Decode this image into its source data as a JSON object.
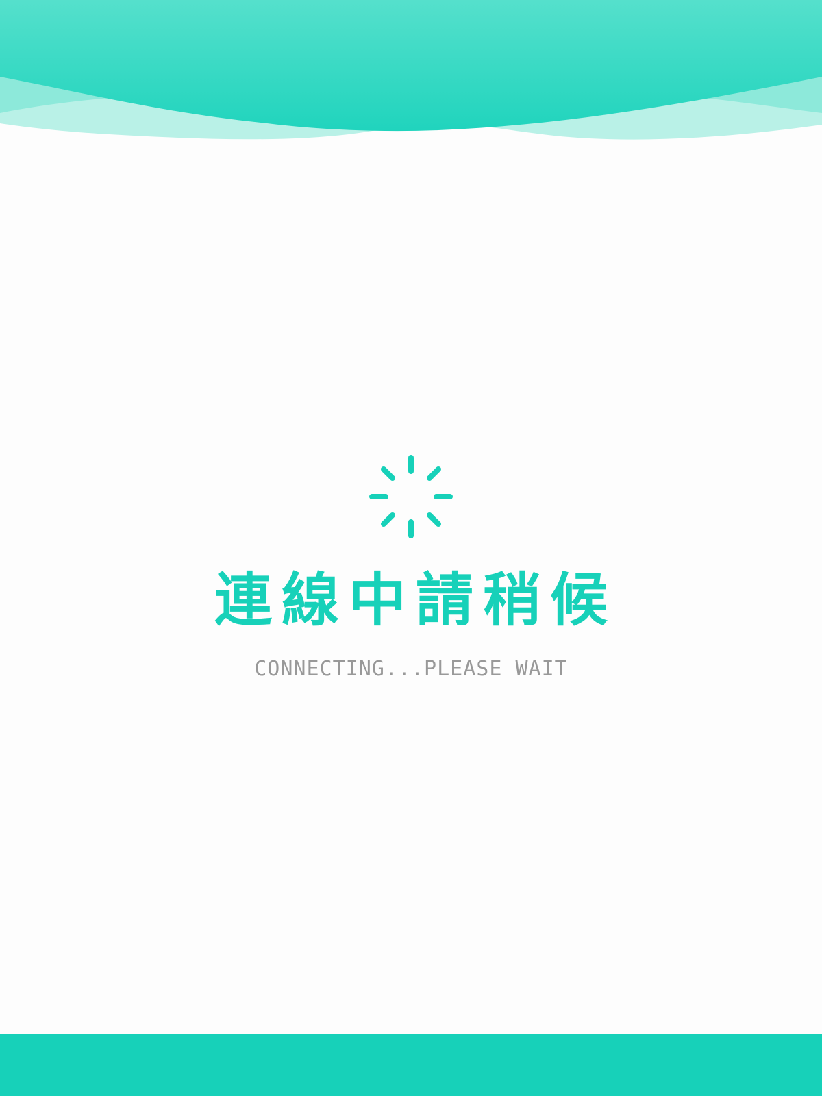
{
  "colors": {
    "accent": "#17d1b9",
    "accent_light": "#55e0cc",
    "background": "#fdfdfd",
    "subtitle": "#999999"
  },
  "header": {
    "decoration": "wave-banner"
  },
  "loader": {
    "icon": "spinner-icon",
    "title": "連線中請稍候",
    "subtitle": "CONNECTING...PLEASE WAIT"
  },
  "footer": {
    "decoration": "solid-bar"
  }
}
